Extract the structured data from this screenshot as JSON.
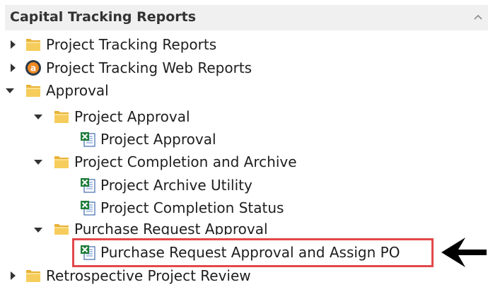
{
  "panel": {
    "title": "Capital Tracking Reports"
  },
  "tree": {
    "items": [
      {
        "label": "Project Tracking Reports",
        "icon": "folder-icon",
        "state": "collapsed"
      },
      {
        "label": "Project Tracking Web Reports",
        "icon": "web-report-icon",
        "state": "collapsed"
      },
      {
        "label": "Approval",
        "icon": "folder-icon",
        "state": "expanded"
      },
      {
        "label": "Project Approval",
        "icon": "folder-icon",
        "state": "expanded"
      },
      {
        "label": "Project Approval",
        "icon": "excel-report-icon",
        "state": "leaf"
      },
      {
        "label": "Project Completion and Archive",
        "icon": "folder-icon",
        "state": "expanded"
      },
      {
        "label": "Project Archive Utility",
        "icon": "excel-report-icon",
        "state": "leaf"
      },
      {
        "label": "Project Completion Status",
        "icon": "excel-report-icon",
        "state": "leaf"
      },
      {
        "label": "Purchase Request Approval",
        "icon": "folder-icon",
        "state": "expanded"
      },
      {
        "label": "Purchase Request Approval and Assign PO",
        "icon": "excel-report-icon",
        "state": "leaf",
        "highlighted": true
      },
      {
        "label": "Retrospective Project Review",
        "icon": "folder-icon",
        "state": "collapsed"
      }
    ]
  },
  "colors": {
    "highlight_border": "#e2484a",
    "header_bg": "#f0f0f0",
    "folder": "#f3c24b",
    "excel_green": "#1e7d3a",
    "arrow": "#000000"
  }
}
